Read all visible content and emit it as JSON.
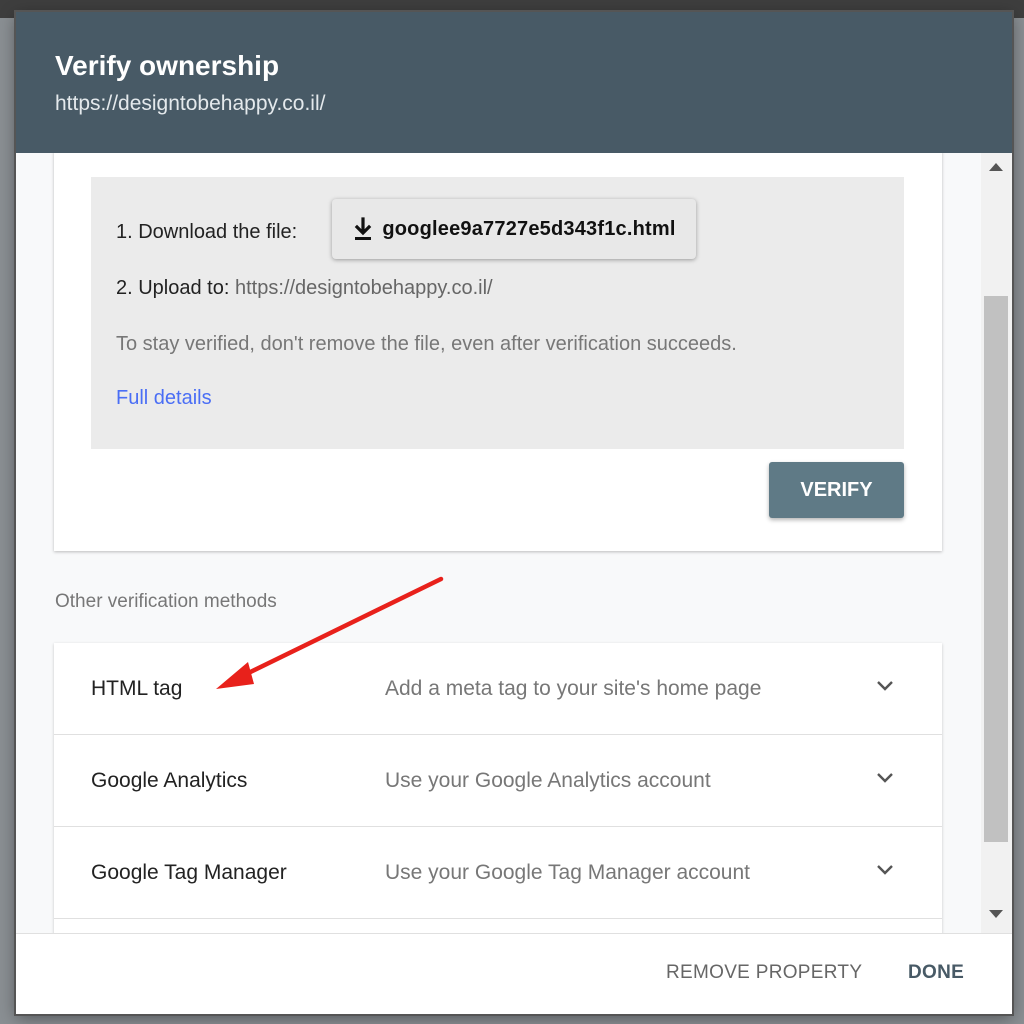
{
  "background": {
    "text": "... ... ... ... ... ..."
  },
  "dialog": {
    "title": "Verify ownership",
    "url": "https://designtobehappy.co.il/"
  },
  "instructions": {
    "step1_label": "1. Download the file:",
    "download_file": "googlee9a7727e5d343f1c.html",
    "step2_label": "2. Upload to:",
    "step2_url": "https://designtobehappy.co.il/",
    "note": "To stay verified, don't remove the file, even after verification succeeds.",
    "full_details": "Full details",
    "verify_label": "VERIFY"
  },
  "other_methods": {
    "heading": "Other verification methods",
    "items": [
      {
        "name": "HTML tag",
        "description": "Add a meta tag to your site's home page",
        "icon": "chevron-down-icon"
      },
      {
        "name": "Google Analytics",
        "description": "Use your Google Analytics account",
        "icon": "chevron-down-icon"
      },
      {
        "name": "Google Tag Manager",
        "description": "Use your Google Tag Manager account",
        "icon": "chevron-down-icon"
      }
    ]
  },
  "footer": {
    "remove_label": "REMOVE PROPERTY",
    "done_label": "DONE"
  },
  "colors": {
    "header": "#485a66",
    "verify_button": "#5f7a86",
    "link": "#4a6ef5",
    "annotation_arrow": "#e8211b"
  }
}
